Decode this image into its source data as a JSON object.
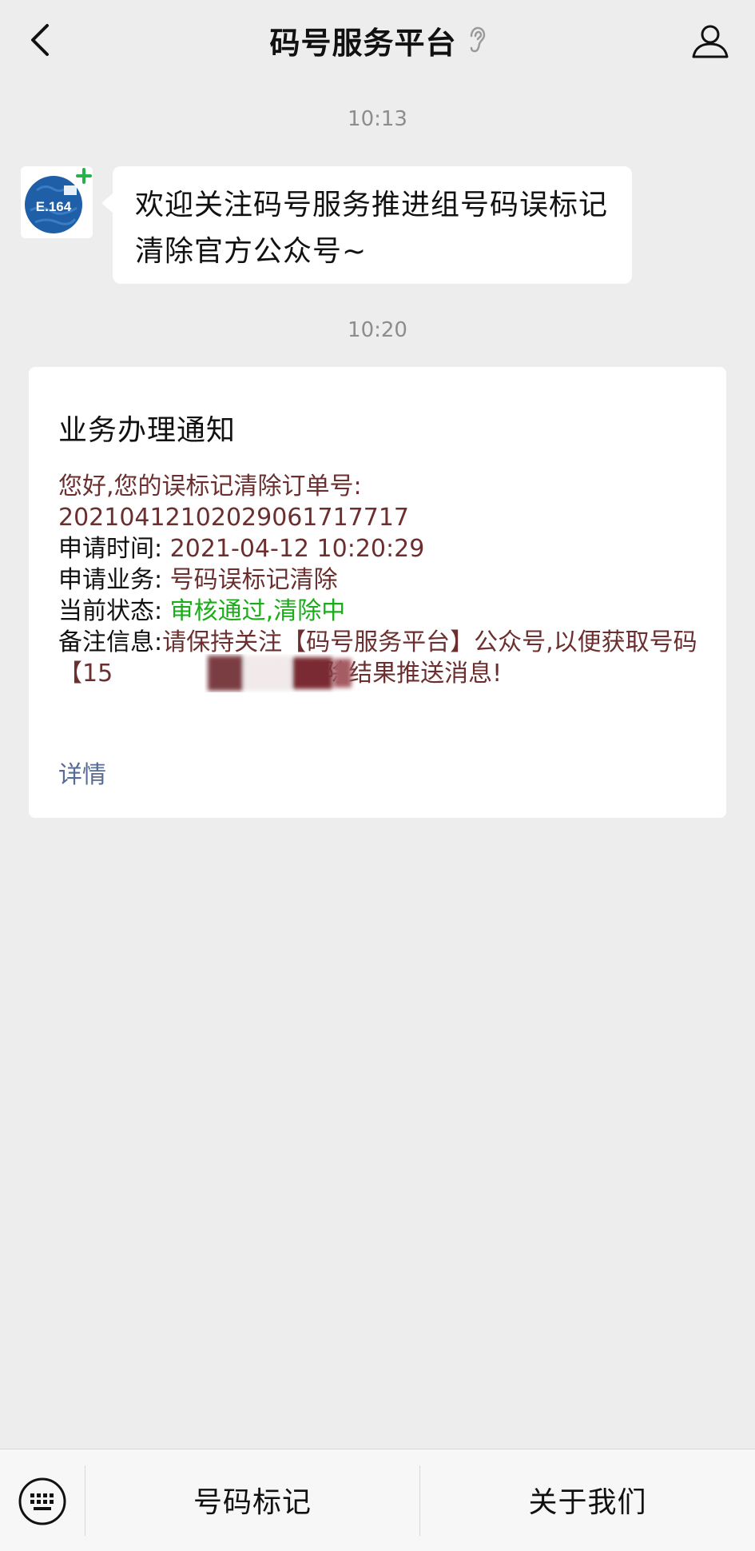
{
  "header": {
    "title": "码号服务平台",
    "back_icon": "chevron-left-icon",
    "ear_icon": "ear-icon",
    "profile_icon": "person-icon"
  },
  "messages": {
    "time1": "10:13",
    "avatar_label": "E.164",
    "welcome_text": "欢迎关注码号服务推进组号码误标记清除官方公众号~",
    "time2": "10:20"
  },
  "card": {
    "title": "业务办理通知",
    "line1": "您好,您的误标记清除订单号:",
    "order_no": "20210412102029061717717",
    "apply_time_label": "申请时间:",
    "apply_time_value": "2021-04-12 10:20:29",
    "service_label": "申请业务:",
    "service_value": "号码误标记清除",
    "status_label": "当前状态:",
    "status_value": "审核通过,清除中",
    "note_label": "备注信息:",
    "note_value_part1": "请保持关注【码号服务平台】公众号,以便获取号码【15",
    "note_value_part2": "】清除结果推送消息!",
    "detail_link": "详情"
  },
  "bottom_menu": {
    "keyboard_icon": "keyboard-icon",
    "item1": "号码标记",
    "item2": "关于我们"
  },
  "colors": {
    "background": "#ededed",
    "card_text": "#6b2f2f",
    "status_ok": "#1aad19",
    "link": "#576b95",
    "avatar_blue": "#1f5fa8",
    "plus_green": "#27b34a"
  }
}
